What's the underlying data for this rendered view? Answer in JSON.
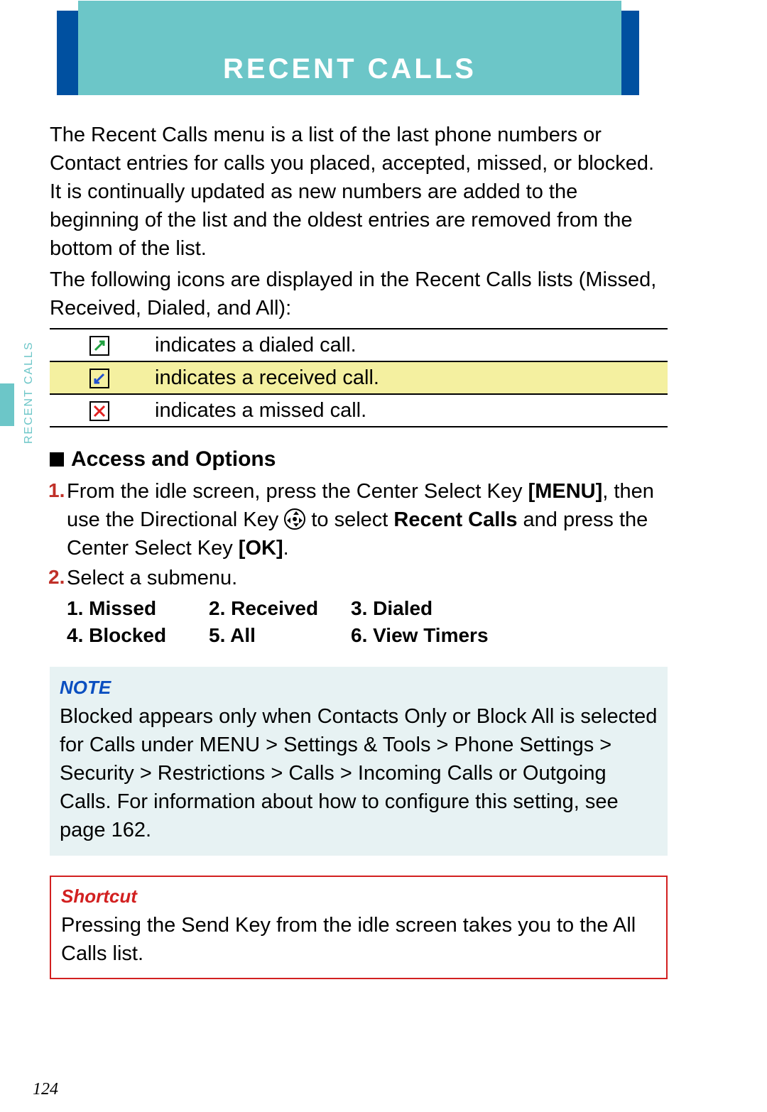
{
  "header": {
    "title": "RECENT CALLS"
  },
  "side_label": "RECENT CALLS",
  "intro": {
    "p1": "The Recent Calls menu is a list of the last phone numbers or Contact entries for calls you placed, accepted, missed, or blocked. It is continually updated as new numbers are added to the beginning of the list and the oldest entries are removed from the bottom of the list.",
    "p2": "The following icons are displayed in the Recent Calls lists (Missed, Received, Dialed, and All):"
  },
  "icon_table": [
    {
      "icon": "dialed",
      "desc": "indicates a dialed call."
    },
    {
      "icon": "received",
      "desc": "indicates a received call."
    },
    {
      "icon": "missed",
      "desc": "indicates a missed call."
    }
  ],
  "section": {
    "title": "Access and Options",
    "steps": {
      "s1a": "From the idle screen, press the Center Select Key ",
      "s1_menu": "[MENU]",
      "s1b": ", then use the Directional Key ",
      "s1c": " to select ",
      "s1_recent": "Recent Calls",
      "s1d": " and press the Center Select Key ",
      "s1_ok": "[OK]",
      "s1e": ".",
      "s2": "Select a submenu."
    },
    "submenus": [
      "1. Missed",
      "2. Received",
      "3. Dialed",
      "4. Blocked",
      "5. All",
      "6. View Timers"
    ]
  },
  "note": {
    "title": "NOTE",
    "body": "Blocked appears only when Contacts Only or Block All is selected for Calls under MENU > Settings & Tools > Phone Settings > Security > Restrictions > Calls > Incoming Calls or Outgoing Calls. For information about how to configure this setting, see page 162."
  },
  "shortcut": {
    "title": "Shortcut",
    "body": "Pressing the Send Key from the idle screen takes you to the All Calls list."
  },
  "page_number": "124"
}
